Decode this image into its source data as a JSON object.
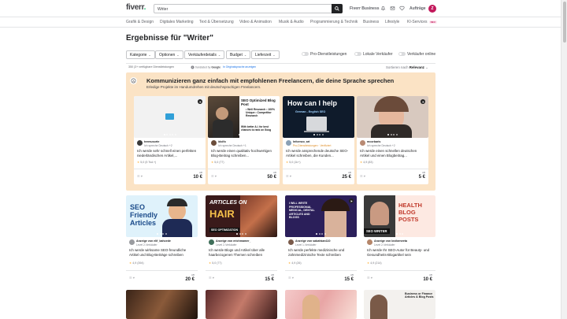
{
  "header": {
    "logo": "fiverr",
    "logo_dot": ".",
    "search_value": "Writer",
    "links": {
      "business": "Fiverr Business",
      "orders": "Aufträge"
    },
    "avatar_initial": "Z"
  },
  "categories": [
    "Grafik & Design",
    "Digitales Marketing",
    "Text & Übersetzung",
    "Video & Animation",
    "Musik & Audio",
    "Programmierung & Technik",
    "Business",
    "Lifestyle",
    "KI-Services"
  ],
  "categories_new_badge": "NEU",
  "page_title": "Ergebnisse für \"Writer\"",
  "filters": [
    "Kategorie",
    "Optionen",
    "Verkäuferdetails",
    "Budget",
    "Lieferzeit"
  ],
  "toggles": [
    "Pro-Dienstleistungen",
    "Lokale Verkäufer",
    "Verkäufer online"
  ],
  "results_count": "350 (3+ verfügbare Dienstleistungen",
  "powered": {
    "prefix": "translated by",
    "google": "Google",
    "orig": "In Originalsprache anzeigen"
  },
  "sort": {
    "label": "Sortieren nach",
    "value": "Relevanz"
  },
  "promo": {
    "title": "Kommunizieren ganz einfach mit empfohlenen Freelancern, die deine Sprache sprechen",
    "subtitle": "Erledige Projekte im Handumdrehen mit deutschsprachigen Freelancern."
  },
  "gigs": [
    {
      "seller": "teemusorte",
      "level": "Ich spreche Deutsch +2",
      "title": "Ich werde sehr schnell einen perfekten niederländischen Artikel,...",
      "rating": "5,0",
      "reviews": "(5 Tsd.+)",
      "from": "AB",
      "price": "10 €"
    },
    {
      "seller": "idolfo",
      "level": "Ich spreche Deutsch +1",
      "title": "Ich werde einen qualitativ hochwertigen Blog-Beitrag schreiben...",
      "rating": "5,0",
      "reviews": "(77)",
      "from": "AB",
      "price": "50 €"
    },
    {
      "seller": "Infoenzo_art",
      "level": "Pro-Dienstleistungen · Verifiziert",
      "title": "Ich werde ansprechende deutsche SEO-Artikel schreiben, die Kunden...",
      "rating": "5,0",
      "reviews": "(1k+)",
      "from": "AB",
      "price": "25 €"
    },
    {
      "seller": "mcorbaris",
      "level": "Ich spreche Deutsch +2",
      "title": "Ich werde einen schnellen deutschen Artikel und einen Blogbeitrag...",
      "rating": "4,9",
      "reviews": "(83)",
      "from": "AB",
      "price": "5 €"
    },
    {
      "seller": "Anzeige von elif_bahcede",
      "level": "Level 2-Verkäufer",
      "title": "Ich werde wirksame SEO-freundliche Artikel und Blog-Beiträge schreiben",
      "rating": "4,9",
      "reviews": "(394)",
      "from": "AB",
      "price": "20 €"
    },
    {
      "seller": "Anzeige von erichmamer_",
      "level": "Level 2-Verkäufer",
      "title": "Ich werde Blogs und Artikel über alle haarbezogenen Themen schreiben",
      "rating": "5,0",
      "reviews": "(77)",
      "from": "AB",
      "price": "15 €"
    },
    {
      "seller": "Anzeige von sabahkan110",
      "level": "Level 1-Verkäufer",
      "title": "Ich werde perfekte medizinische und zahnmedizinische Texte schreiben",
      "rating": "4,9",
      "reviews": "(26)",
      "from": "AB",
      "price": "15 €"
    },
    {
      "seller": "Anzeige von lovibeneeta",
      "level": "Level 2-Verkäufer",
      "title": "Ich werde Ihr SEO-Autor für Beauty- und Gesundheits-Blogartikel sein",
      "rating": "4,9",
      "reviews": "(214)",
      "from": "AB",
      "price": "10 €"
    }
  ],
  "thumb_text": {
    "g2_title": "SEO Optimized Blog Post",
    "g2_bullets": "• Well Research • 100% Unique • Competitor Research",
    "g2_sub": "With better A.I. for best chances to rank on Goog",
    "g3_title": "How can I help",
    "g3_sub": "German - English SEO",
    "g5": "SEO Friendly Articles",
    "g6_a": "ARTICLES ON",
    "g6_b": "HAIR",
    "g6_c": "SEO OPTIMIZATION",
    "g7": "I WILL WRITE PROFESSIONAL MEDICAL, DENTAL ARTICLES AND BLOGS",
    "g8_a": "HEALTH",
    "g8_b": "BLOG",
    "g8_c": "POSTS",
    "g8_d": "SEO WRITER",
    "g12": "Business or Finance Articles & Blog Posts"
  },
  "colors": {
    "brand": "#1dbf73",
    "promo_bg": "#fbe3c5",
    "star": "#ffb33e"
  }
}
